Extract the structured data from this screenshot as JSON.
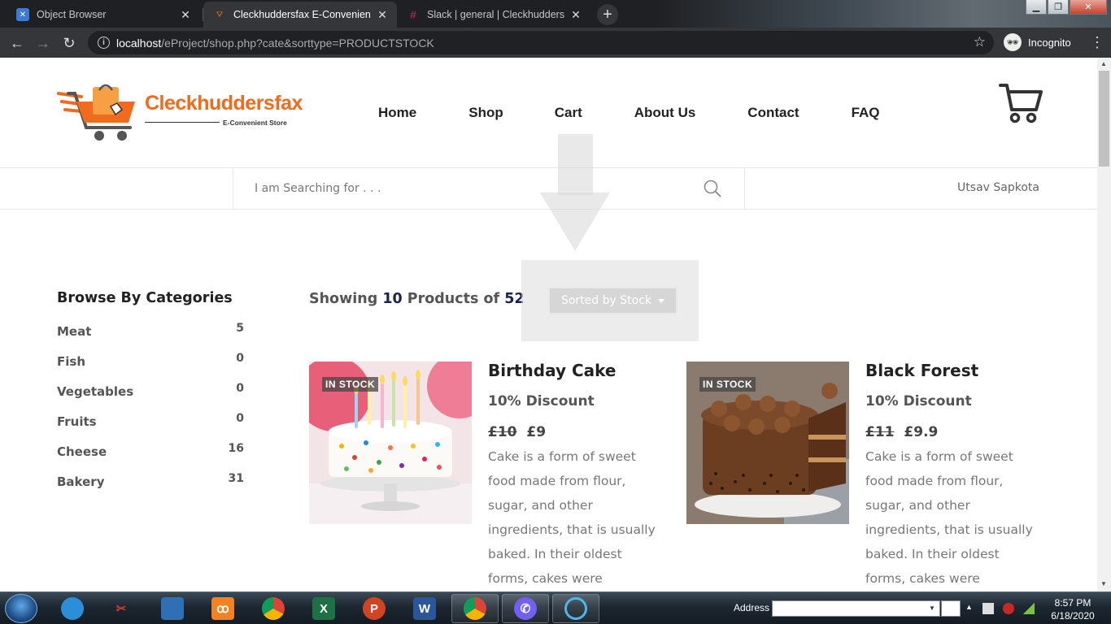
{
  "browser": {
    "tabs": [
      {
        "title": "Object Browser",
        "active": false
      },
      {
        "title": "Cleckhuddersfax E-Convenient St",
        "active": true
      },
      {
        "title": "Slack | general | Cleckhuddersfax",
        "active": false
      }
    ],
    "url_host": "localhost",
    "url_path": "/eProject/shop.php?cate&sorttype=PRODUCTSTOCK",
    "incognito_label": "Incognito"
  },
  "site": {
    "logo_name": "Cleckhuddersfax",
    "logo_tagline": "E-Convenient Store",
    "nav": [
      "Home",
      "Shop",
      "Cart",
      "About Us",
      "Contact",
      "FAQ"
    ],
    "search_placeholder": "I am Searching for . . .",
    "username": "Utsav Sapkota"
  },
  "sidebar": {
    "heading": "Browse By Categories",
    "categories": [
      {
        "label": "Meat",
        "count": "5"
      },
      {
        "label": "Fish",
        "count": "0"
      },
      {
        "label": "Vegetables",
        "count": "0"
      },
      {
        "label": "Fruits",
        "count": "0"
      },
      {
        "label": "Cheese",
        "count": "16"
      },
      {
        "label": "Bakery",
        "count": "31"
      }
    ]
  },
  "listing": {
    "showing_prefix": "Showing",
    "shown": "10",
    "mid_text": "Products of",
    "total": "52",
    "sort_label": "Sorted by Stock"
  },
  "products": [
    {
      "badge": "IN STOCK",
      "title": "Birthday Cake",
      "discount": "10% Discount",
      "old_price": "£10",
      "price": "£9",
      "description": "Cake is a form of sweet food made from flour, sugar, and other ingredients, that is usually baked. In their oldest forms, cakes were"
    },
    {
      "badge": "IN STOCK",
      "title": "Black Forest",
      "discount": "10% Discount",
      "old_price": "£11",
      "price": "£9.9",
      "description": "Cake is a form of sweet food made from flour, sugar, and other ingredients, that is usually baked. In their oldest forms, cakes were"
    }
  ],
  "taskbar": {
    "address_label": "Address",
    "time": "8:57 PM",
    "date": "6/18/2020"
  },
  "colors": {
    "brand_orange": "#f26a1b",
    "nav_dark": "#222222",
    "count_navy": "#1b2348"
  }
}
